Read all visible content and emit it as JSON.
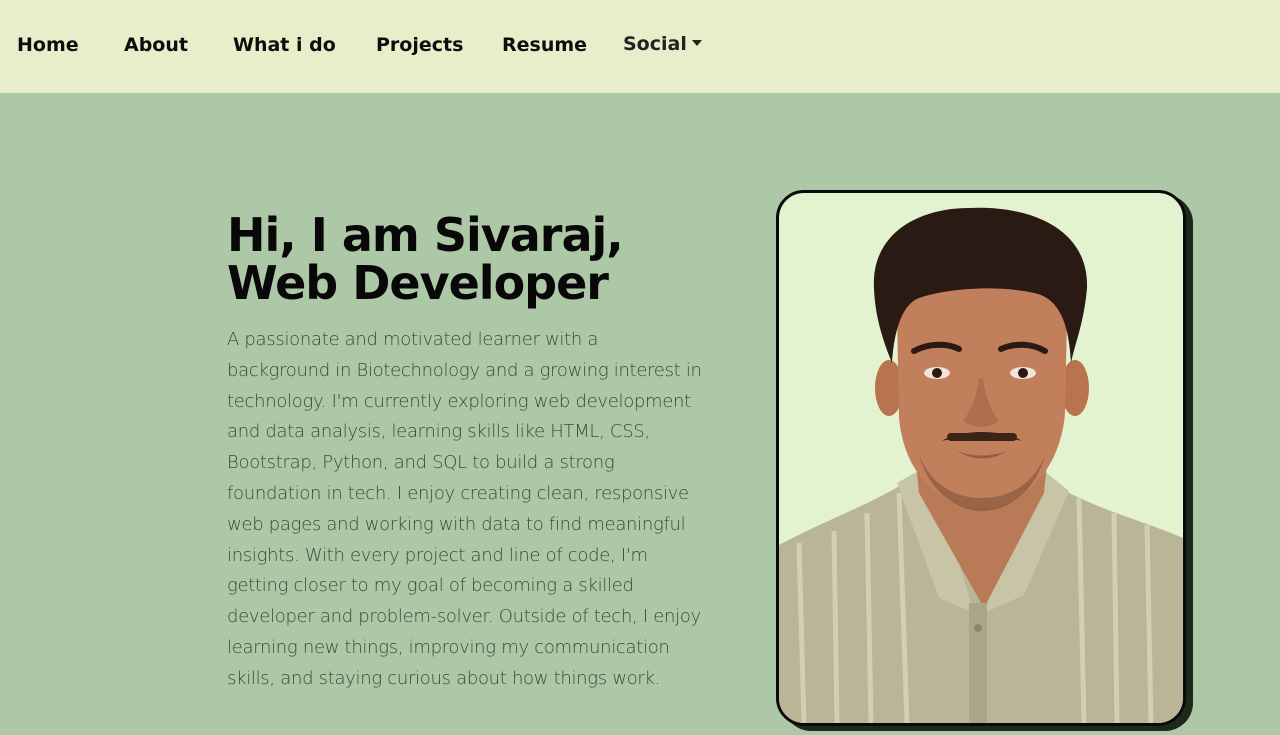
{
  "nav": {
    "home": "Home",
    "about": "About",
    "what_i_do": "What i do",
    "projects": "Projects",
    "resume": "Resume",
    "social": "Social"
  },
  "hero": {
    "title_line1": "Hi, I am Sivaraj,",
    "title_line2": "Web Developer",
    "bio": "A passionate and motivated learner with a background in Biotechnology and a growing interest in technology. I'm currently exploring web development and data analysis, learning skills like HTML, CSS, Bootstrap, Python, and SQL to build a strong foundation in tech. I enjoy creating clean, responsive web pages and working with data to find meaningful insights. With every project and line of code, I'm getting closer to my goal of becoming a skilled developer and problem-solver. Outside of tech, I enjoy learning new things, improving my communication skills, and staying curious about how things work."
  },
  "colors": {
    "page_background": "#adc8a6",
    "navbar_background": "#e6efc9",
    "photo_background": "#e4f3cf"
  },
  "icons": {
    "social_dropdown": "caret-down-icon"
  }
}
